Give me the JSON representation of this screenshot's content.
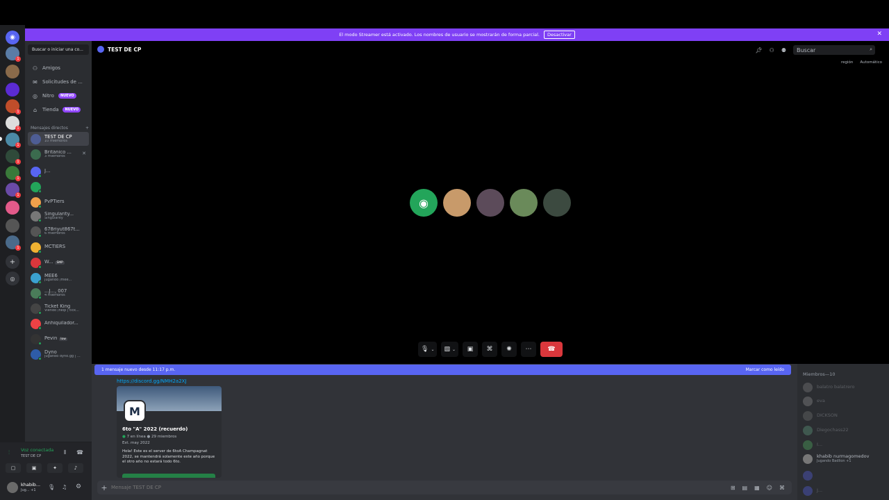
{
  "banner": {
    "text": "El modo Streamer está activado. Los nombres de usuario se mostrarán de forma parcial.",
    "button": "Desactivar"
  },
  "dm_search": "Buscar o iniciar una co...",
  "nav": [
    {
      "label": "Amigos",
      "badge": ""
    },
    {
      "label": "Solicitudes de ...",
      "badge": ""
    },
    {
      "label": "Nitro",
      "badge": "NUEVO"
    },
    {
      "label": "Tienda",
      "badge": "NUEVO"
    }
  ],
  "dm_header": "Mensajes directos",
  "dms": [
    {
      "name": "TEST DE CP",
      "sub": "10 miembros",
      "color": "#4e5d94"
    },
    {
      "name": "Británico ...",
      "sub": "3 miembros",
      "color": "#3b6b4e"
    },
    {
      "name": "J...",
      "sub": "",
      "color": "#5865f2"
    },
    {
      "name": "",
      "sub": "",
      "color": "#23a55a"
    },
    {
      "name": "PvPTiers",
      "sub": "",
      "color": "#f0a04b"
    },
    {
      "name": "Singularity...",
      "sub": "Singularity",
      "color": "#777"
    },
    {
      "name": "678riyut867t...",
      "sub": "6 miembros",
      "color": "#555"
    },
    {
      "name": "MCTIERS",
      "sub": "",
      "color": "#f0b232"
    },
    {
      "name": "W...",
      "sub": "",
      "tag": "SMP",
      "color": "#da373c"
    },
    {
      "name": "MEE6",
      "sub": "Jugando /mee...",
      "color": "#3ba2d0"
    },
    {
      "name": "...J..., 007",
      "sub": "4 miembros",
      "color": "#4a7c59"
    },
    {
      "name": "Ticket King",
      "sub": "Viendo /help | tick...",
      "color": "#444"
    },
    {
      "name": "Anhiquilador...",
      "sub": "",
      "color": "#ed4245"
    },
    {
      "name": "Pevin",
      "sub": "",
      "tag": "low",
      "color": "#333"
    },
    {
      "name": "Dyno",
      "sub": "Jugando dyno.gg | ...",
      "color": "#2e5ca8"
    }
  ],
  "voice": {
    "status": "Voz conectada",
    "channel": "TEST DE CP"
  },
  "user": {
    "name": "khabib...",
    "status": "Jug... +1"
  },
  "call": {
    "title": "TEST DE CP",
    "search_placeholder": "Buscar",
    "region_label": "región",
    "region_value": "Automático"
  },
  "participants": [
    "#23a55a",
    "#c89a6a",
    "#5c4b5a",
    "#6a8a5a",
    "#3c4a40"
  ],
  "chat": {
    "new_messages": "1 mensaje nuevo desde 11:17 p.m.",
    "mark_read": "Marcar como leído",
    "link": "https://discord.gg/NMH2a2XJ",
    "invite": {
      "name": "6to \"A\" 2022 (recuerdo)",
      "online": "7 en línea",
      "members": "29 miembros",
      "est": "Est. may 2022",
      "description": "Hola! Este es el server de 6toA Champagnat 2022, se mantendrá solamente este año porque el otro año no estará todo 6to."
    },
    "placeholder": "Mensaje TEST DE CP"
  },
  "members": {
    "header": "Miembros—10",
    "list": [
      {
        "name": "balatro balatrero",
        "sub": "",
        "color": "#888",
        "on": false
      },
      {
        "name": "eva",
        "sub": "",
        "color": "#999",
        "on": false
      },
      {
        "name": "DICKSON",
        "sub": "",
        "color": "#777",
        "on": false
      },
      {
        "name": "Diegochass22",
        "sub": "",
        "color": "#6a8",
        "on": false
      },
      {
        "name": "I...",
        "sub": "",
        "color": "#5b6",
        "on": false
      },
      {
        "name": "khabib nurmagomedov",
        "sub": "Jugando Badlion +1",
        "color": "#777",
        "on": true
      },
      {
        "name": "",
        "sub": "",
        "color": "#5865f2",
        "on": false
      },
      {
        "name": "J...",
        "sub": "",
        "color": "#5865f2",
        "on": false
      }
    ]
  }
}
